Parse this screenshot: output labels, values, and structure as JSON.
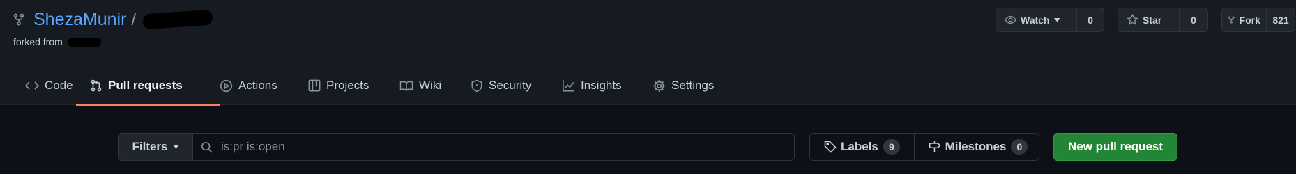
{
  "repo": {
    "owner": "ShezaMunir",
    "separator": "/",
    "forked_from_label": "forked from",
    "icon": "repo-forked-icon"
  },
  "actions": {
    "watch": {
      "label": "Watch",
      "count": "0",
      "icon": "eye-icon"
    },
    "star": {
      "label": "Star",
      "count": "0",
      "icon": "star-icon"
    },
    "fork": {
      "label": "Fork",
      "count": "821",
      "icon": "fork-icon"
    }
  },
  "tabs": [
    {
      "label": "Code",
      "icon": "code-icon",
      "active": false
    },
    {
      "label": "Pull requests",
      "icon": "pull-request-icon",
      "active": true
    },
    {
      "label": "Actions",
      "icon": "play-icon",
      "active": false
    },
    {
      "label": "Projects",
      "icon": "table-icon",
      "active": false
    },
    {
      "label": "Wiki",
      "icon": "book-icon",
      "active": false
    },
    {
      "label": "Security",
      "icon": "shield-icon",
      "active": false
    },
    {
      "label": "Insights",
      "icon": "graph-icon",
      "active": false
    },
    {
      "label": "Settings",
      "icon": "gear-icon",
      "active": false
    }
  ],
  "filter_bar": {
    "filters_label": "Filters",
    "search_value": "is:pr is:open"
  },
  "labels": {
    "label": "Labels",
    "count": "9"
  },
  "milestones": {
    "label": "Milestones",
    "count": "0"
  },
  "new_pull_request_label": "New pull request",
  "colors": {
    "background": "#0d1117",
    "header_background": "#161b22",
    "link": "#58a6ff",
    "active_tab_underline": "#f78166",
    "primary_button": "#238636"
  }
}
